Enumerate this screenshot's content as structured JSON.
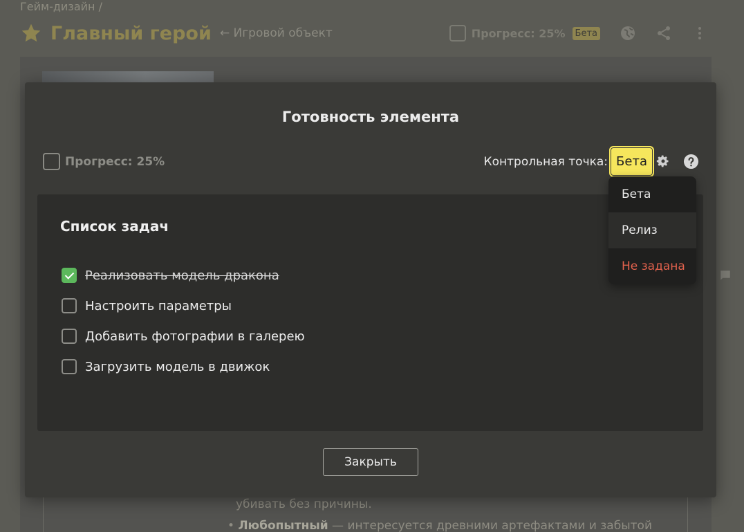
{
  "background": {
    "breadcrumb": "Гейм-дизайн /",
    "title": "Главный герой",
    "back_link": "← Игровой объект",
    "header_progress": "Прогресс: 25%",
    "header_badge": "Бета",
    "text_line1": "убивать без причины.",
    "text_line2_bold": "Любопытный",
    "text_line2_rest": " — интересуется древними артефактами и забытой"
  },
  "modal": {
    "title": "Готовность элемента",
    "progress_label": "Прогресс: 25%",
    "milestone_label": "Контрольная точка:",
    "milestone_value": "Бета",
    "task_list_title": "Список задач",
    "tasks": [
      {
        "label": "Реализовать модель дракона",
        "done": true
      },
      {
        "label": "Настроить параметры",
        "done": false
      },
      {
        "label": "Добавить фотографии в галерею",
        "done": false
      },
      {
        "label": "Загрузить модель в движок",
        "done": false
      }
    ],
    "close_label": "Закрыть"
  },
  "dropdown": {
    "options": [
      "Бета",
      "Релиз",
      "Не задана"
    ]
  },
  "colors": {
    "accent_yellow": "#f6e65c",
    "done_green": "#5cb85c",
    "danger_red": "#e3624d"
  },
  "icons": [
    "star-icon",
    "globe-icon",
    "share-icon",
    "more-vertical-icon",
    "gear-icon",
    "help-icon",
    "check-icon",
    "comment-icon"
  ]
}
